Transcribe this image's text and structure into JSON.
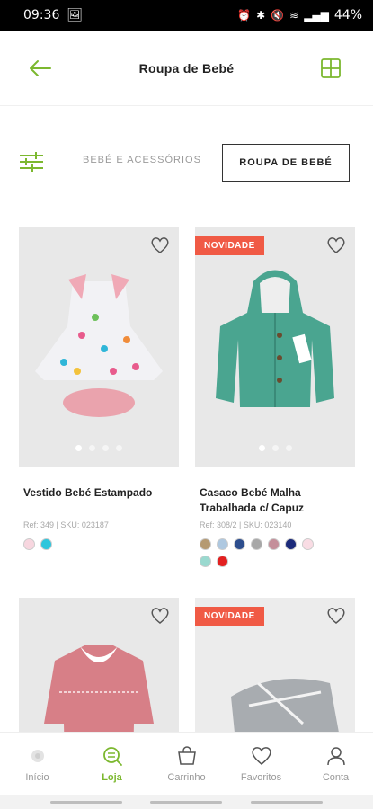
{
  "status": {
    "time": "09:36",
    "battery": "44%"
  },
  "header": {
    "title": "Roupa de Bebé"
  },
  "filters": {
    "inactive_chip": "BEBÉ E ACESSÓRIOS",
    "active_chip": "ROUPA DE BEBÉ"
  },
  "products": [
    {
      "name": "Vestido Bebé Estampado",
      "ref": "Ref: 349 | SKU: 023187",
      "badge": "",
      "swatches": [
        "#f7d6df",
        "#2fc6dc"
      ]
    },
    {
      "name": "Casaco Bebé Malha Trabalhada c/ Capuz",
      "ref": "Ref: 308/2 | SKU: 023140",
      "badge": "NOVIDADE",
      "swatches": [
        "#b59a72",
        "#aec8e0",
        "#2d4e8e",
        "#a7a7a7",
        "#c48f9a",
        "#1b2a7a",
        "#f9dce4",
        "#9ad9cf",
        "#e32020"
      ]
    },
    {
      "name": "",
      "ref": "",
      "badge": "",
      "swatches": []
    },
    {
      "name": "",
      "ref": "",
      "badge": "NOVIDADE",
      "swatches": []
    }
  ],
  "nav": {
    "items": [
      {
        "label": "Início",
        "icon": "home-icon"
      },
      {
        "label": "Loja",
        "icon": "shop-search-icon"
      },
      {
        "label": "Carrinho",
        "icon": "cart-icon"
      },
      {
        "label": "Favoritos",
        "icon": "heart-icon"
      },
      {
        "label": "Conta",
        "icon": "user-icon"
      }
    ]
  },
  "colors": {
    "accent": "#7cb82f",
    "badge": "#f05a45"
  }
}
